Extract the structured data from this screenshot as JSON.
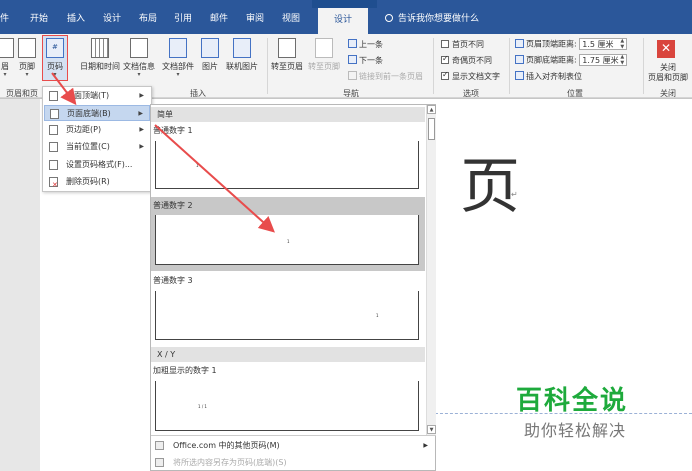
{
  "tabs": {
    "file": "件",
    "home": "开始",
    "insert": "插入",
    "design": "设计",
    "layout": "布局",
    "references": "引用",
    "mailings": "邮件",
    "review": "审阅",
    "view": "视图",
    "hf_design": "设计",
    "tell_me": "告诉我你想要做什么"
  },
  "ribbon": {
    "header": "眉",
    "footer": "页脚",
    "page_number": "页码",
    "date_time": "日期和时间",
    "doc_info": "文档信息",
    "quick_parts": "文档部件",
    "pictures": "图片",
    "online_pictures": "联机图片",
    "goto_header": "转至页眉",
    "goto_footer": "转至页脚",
    "prev": "上一条",
    "next": "下一条",
    "link_prev": "链接到前一条页眉",
    "diff_first": "首页不同",
    "diff_odd_even": "奇偶页不同",
    "show_doc_text": "显示文档文字",
    "header_top": "页眉顶端距离:",
    "header_top_val": "1.5 厘米",
    "footer_bottom": "页脚底端距离:",
    "footer_bottom_val": "1.75 厘米",
    "insert_align_tab": "插入对齐制表位",
    "close_label1": "关闭",
    "close_label2": "页眉和页脚",
    "groups": {
      "hf": "页眉和页",
      "insert": "插入",
      "nav": "导航",
      "options": "选项",
      "position": "位置",
      "close": "关闭"
    }
  },
  "menu": {
    "items": [
      {
        "label": "页面顶端(T)"
      },
      {
        "label": "页面底端(B)"
      },
      {
        "label": "页边距(P)"
      },
      {
        "label": "当前位置(C)"
      },
      {
        "label": "设置页码格式(F)..."
      },
      {
        "label": "删除页码(R)"
      }
    ]
  },
  "gallery": {
    "section_simple": "简单",
    "item1": "普通数字 1",
    "item2": "普通数字 2",
    "item3": "普通数字 3",
    "section_xy": "X / Y",
    "item4": "加粗显示的数字 1",
    "thumb_num": "1",
    "thumb_xy": "1 / 1",
    "more": "Office.com 中的其他页码(M)",
    "save_selection": "将所选内容另存为页码(底端)(S)"
  },
  "document": {
    "glyph": "页",
    "para_mark": "↵"
  },
  "watermark": {
    "title": "百科全说",
    "subtitle": "助你轻松解决"
  },
  "colors": {
    "word_blue": "#2b579a",
    "watermark_green": "#1eaa3c",
    "annotation_red": "#e84c4c"
  }
}
